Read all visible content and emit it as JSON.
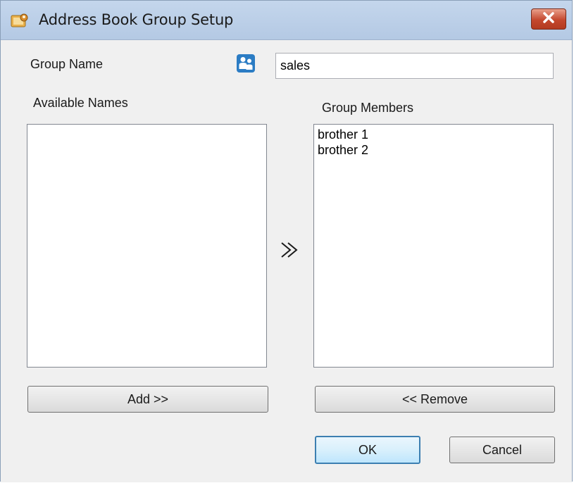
{
  "window": {
    "title": "Address Book Group Setup",
    "title_icon": "address-book-icon",
    "close_icon": "close-icon",
    "close_color": "#c4482e"
  },
  "form": {
    "group_name_label": "Group Name",
    "group_name_value": "sales",
    "group_icon": "group-users-icon",
    "available_label": "Available Names",
    "members_label": "Group Members",
    "available_names": [],
    "group_members": [
      "brother 1",
      "brother 2"
    ],
    "move_icon": "double-chevron-right-icon"
  },
  "buttons": {
    "add_label": "Add >>",
    "remove_label": "<< Remove",
    "ok_label": "OK",
    "cancel_label": "Cancel"
  },
  "colors": {
    "focus_border": "#3c7fb1",
    "titlebar": "#b4c9e4",
    "group_icon": "#2b7cc4"
  }
}
